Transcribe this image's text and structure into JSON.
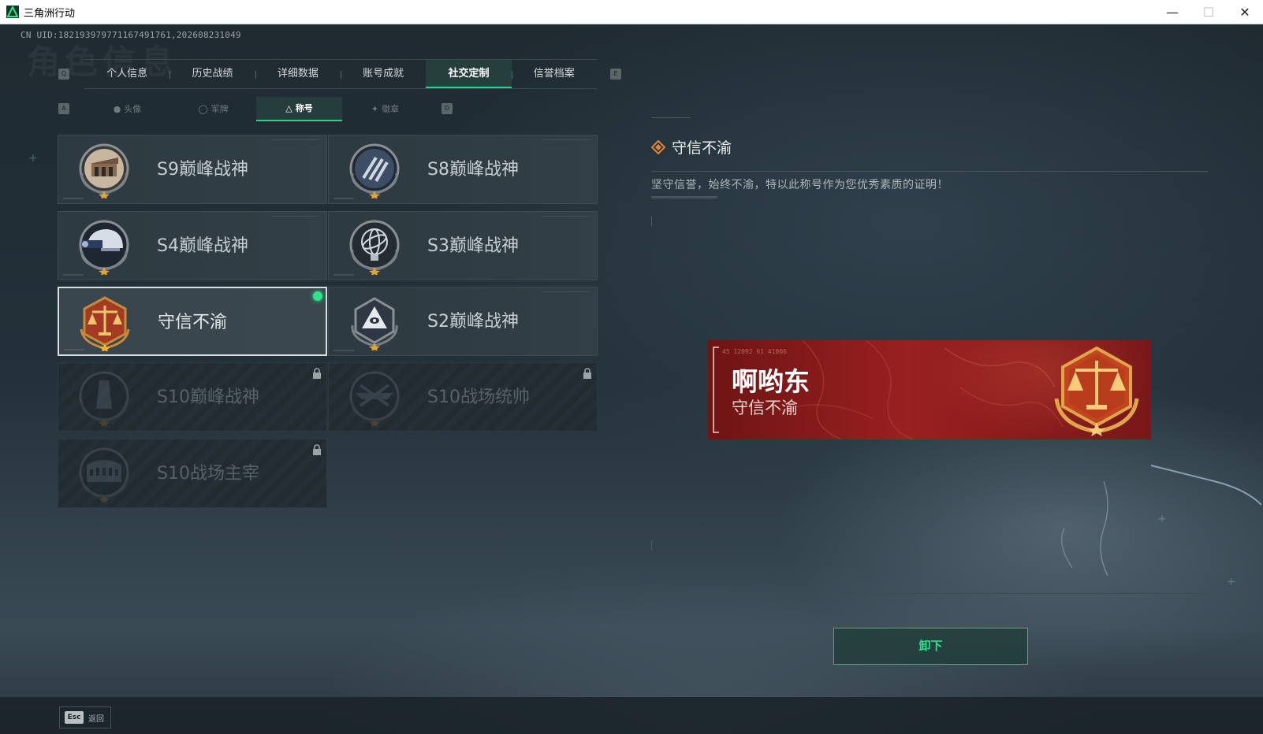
{
  "window": {
    "title": "三角洲行动",
    "controls": {
      "minimize": "—",
      "maximize": "☐",
      "close": "✕"
    }
  },
  "uid_text": "CN UID:18219397977116749176​1,202608231049",
  "watermark": "角色信息",
  "key_hints": {
    "prev_tab": "Q",
    "next_tab": "E",
    "prev_sub": "A",
    "next_sub": "D"
  },
  "main_tabs": [
    {
      "label": "个人信息",
      "active": false
    },
    {
      "label": "历史战绩",
      "active": false
    },
    {
      "label": "详细数据",
      "active": false
    },
    {
      "label": "账号成就",
      "active": false
    },
    {
      "label": "社交定制",
      "active": true
    },
    {
      "label": "信誉档案",
      "active": false
    }
  ],
  "sub_tabs": [
    {
      "label": "头像",
      "icon": "person-icon",
      "active": false
    },
    {
      "label": "军牌",
      "icon": "dogtag-icon",
      "active": false
    },
    {
      "label": "称号",
      "icon": "title-triangle-icon",
      "active": true
    },
    {
      "label": "徽章",
      "icon": "emblem-icon",
      "active": false
    }
  ],
  "titles": [
    {
      "label": "S9巅峰战神",
      "emblem": "arch-gate-emblem",
      "locked": false,
      "equipped": false
    },
    {
      "label": "S8巅峰战神",
      "emblem": "slash-stripes-emblem",
      "locked": false,
      "equipped": false
    },
    {
      "label": "S4巅峰战神",
      "emblem": "night-vision-helmet-emblem",
      "locked": false,
      "equipped": false
    },
    {
      "label": "S3巅峰战神",
      "emblem": "armillary-globe-emblem",
      "locked": false,
      "equipped": false
    },
    {
      "label": "守信不渝",
      "emblem": "justice-scales-emblem",
      "locked": false,
      "equipped": true
    },
    {
      "label": "S2巅峰战神",
      "emblem": "pyramid-eye-emblem",
      "locked": false,
      "equipped": false
    },
    {
      "label": "S10巅峰战神",
      "emblem": "tower-emblem",
      "locked": true,
      "equipped": false
    },
    {
      "label": "S10战场统帅",
      "emblem": "aircraft-emblem",
      "locked": true,
      "equipped": false
    },
    {
      "label": "S10战场主宰",
      "emblem": "colosseum-emblem",
      "locked": true,
      "equipped": false
    }
  ],
  "detail": {
    "title": "守信不渝",
    "description": "坚守信誉，始终不渝，特以此称号作为您优秀素质的证明！"
  },
  "namecard": {
    "serial": "45 12092  61 41006",
    "player_name": "啊哟东",
    "title": "守信不渝"
  },
  "actions": {
    "unequip": "卸下"
  },
  "footer": {
    "esc_key": "Esc",
    "back_label": "返回"
  },
  "colors": {
    "accent": "#2fd08a",
    "namecard_red": "#9a2021",
    "equipped_dot": "#2ee28a"
  }
}
